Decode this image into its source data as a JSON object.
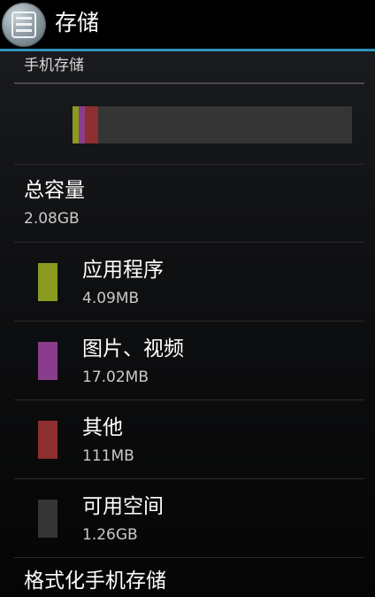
{
  "action_bar": {
    "title": "存储",
    "icon": "storage-settings-icon",
    "accent_color": "#2f93bd"
  },
  "section": {
    "header": "手机存储"
  },
  "usage_bar": {
    "background_color": "#353535",
    "segments": [
      {
        "name": "应用程序",
        "fraction": 0.023,
        "color": "#8a9a1f"
      },
      {
        "name": "图片、视频",
        "fraction": 0.023,
        "color": "#8a3d8c"
      },
      {
        "name": "其他",
        "fraction": 0.048,
        "color": "#8d2f2f"
      }
    ]
  },
  "total": {
    "title": "总容量",
    "value": "2.08GB"
  },
  "items": [
    {
      "label": "应用程序",
      "value": "4.09MB",
      "color": "#8a9a1f"
    },
    {
      "label": "图片、视频",
      "value": "17.02MB",
      "color": "#8a3d8c"
    },
    {
      "label": "其他",
      "value": "111MB",
      "color": "#8d2f2f"
    },
    {
      "label": "可用空间",
      "value": "1.26GB",
      "color": "#353535"
    }
  ],
  "format": {
    "title": "格式化手机存储"
  }
}
